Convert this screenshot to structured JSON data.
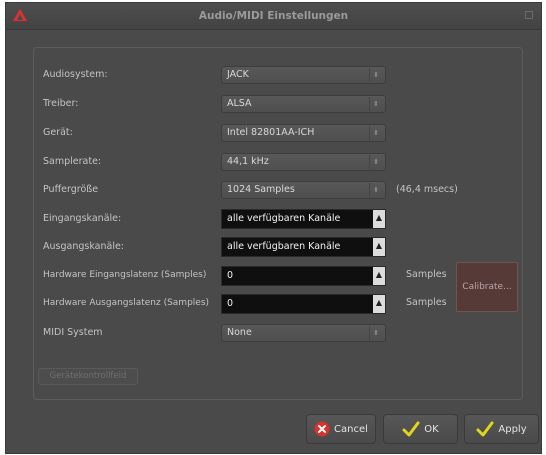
{
  "window": {
    "title": "Audio/MIDI Einstellungen"
  },
  "settings": {
    "audiosystem": {
      "label": "Audiosystem:",
      "value": "JACK"
    },
    "treiber": {
      "label": "Treiber:",
      "value": "ALSA"
    },
    "geraet": {
      "label": "Gerät:",
      "value": "Intel 82801AA-ICH"
    },
    "samplerate": {
      "label": "Samplerate:",
      "value": "44,1 kHz"
    },
    "puffer": {
      "label": "Puffergröße",
      "value": "1024 Samples",
      "note": "(46,4 msecs)"
    },
    "eingang": {
      "label": "Eingangskanäle:",
      "value": "alle verfügbaren Kanäle"
    },
    "ausgang": {
      "label": "Ausgangskanäle:",
      "value": "alle verfügbaren Kanäle"
    },
    "hw_in": {
      "label": "Hardware Eingangslatenz (Samples)",
      "value": "0",
      "unit": "Samples"
    },
    "hw_out": {
      "label": "Hardware Ausgangslatenz (Samples)",
      "value": "0",
      "unit": "Samples"
    },
    "midi": {
      "label": "MIDI System",
      "value": "None"
    }
  },
  "buttons": {
    "calibrate": "Calibrate...",
    "device_control": "Gerätekontrollfeld",
    "cancel": "Cancel",
    "ok": "OK",
    "apply": "Apply"
  },
  "colors": {
    "window_bg": "#4a4a4a",
    "cancel_red": "#d9312b",
    "check_yellow": "#e0d61c",
    "logo_red": "#e03030"
  }
}
